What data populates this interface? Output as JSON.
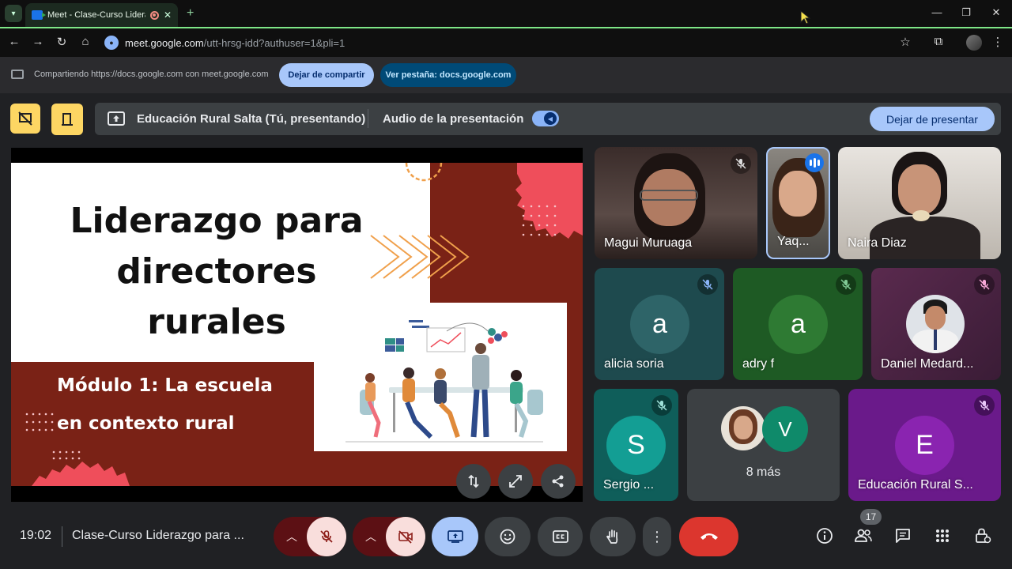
{
  "browser": {
    "tab_title": "Meet - Clase-Curso Liderazgo",
    "tab_close": "✕",
    "new_tab": "+",
    "window_controls": [
      "—",
      "❐",
      "✕"
    ],
    "url_host": "meet.google.com",
    "url_path": "/utt-hrsg-idd?authuser=1&pli=1"
  },
  "share_bar": {
    "message": "Compartiendo https://docs.google.com con meet.google.com",
    "stop_sharing": "Dejar de compartir",
    "view_tab": "Ver pestaña: docs.google.com"
  },
  "presenting_bar": {
    "title": "Educación Rural Salta (Tú, presentando)",
    "audio_label": "Audio de la presentación",
    "stop_presenting": "Dejar de presentar"
  },
  "slide": {
    "title_line1": "Liderazgo para",
    "title_line2": "directores",
    "title_line3": "rurales",
    "module_line1": "Módulo 1: La escuela",
    "module_line2": "en contexto rural"
  },
  "participants": [
    {
      "name": "Magui Muruaga"
    },
    {
      "name": "Yaq..."
    },
    {
      "name": "Naira Diaz"
    },
    {
      "name": "alicia soria",
      "initial": "a"
    },
    {
      "name": "adry f",
      "initial": "a"
    },
    {
      "name": "Daniel Medard..."
    },
    {
      "name": "Sergio ...",
      "initial": "S"
    },
    {
      "more_initial": "V",
      "more_label": "8 más"
    },
    {
      "name": "Educación Rural S...",
      "initial": "E"
    }
  ],
  "bottom_bar": {
    "time": "19:02",
    "meeting_title": "Clase-Curso Liderazgo para ...",
    "participant_count": "17"
  },
  "colors": {
    "slide_red": "#7a2216",
    "slide_pink": "#ef4e5b",
    "accent_blue": "#8ab4f8",
    "end_call_red": "#dc362e",
    "mute_pink": "#f9dedc",
    "yellow_btn": "#fdd663"
  }
}
